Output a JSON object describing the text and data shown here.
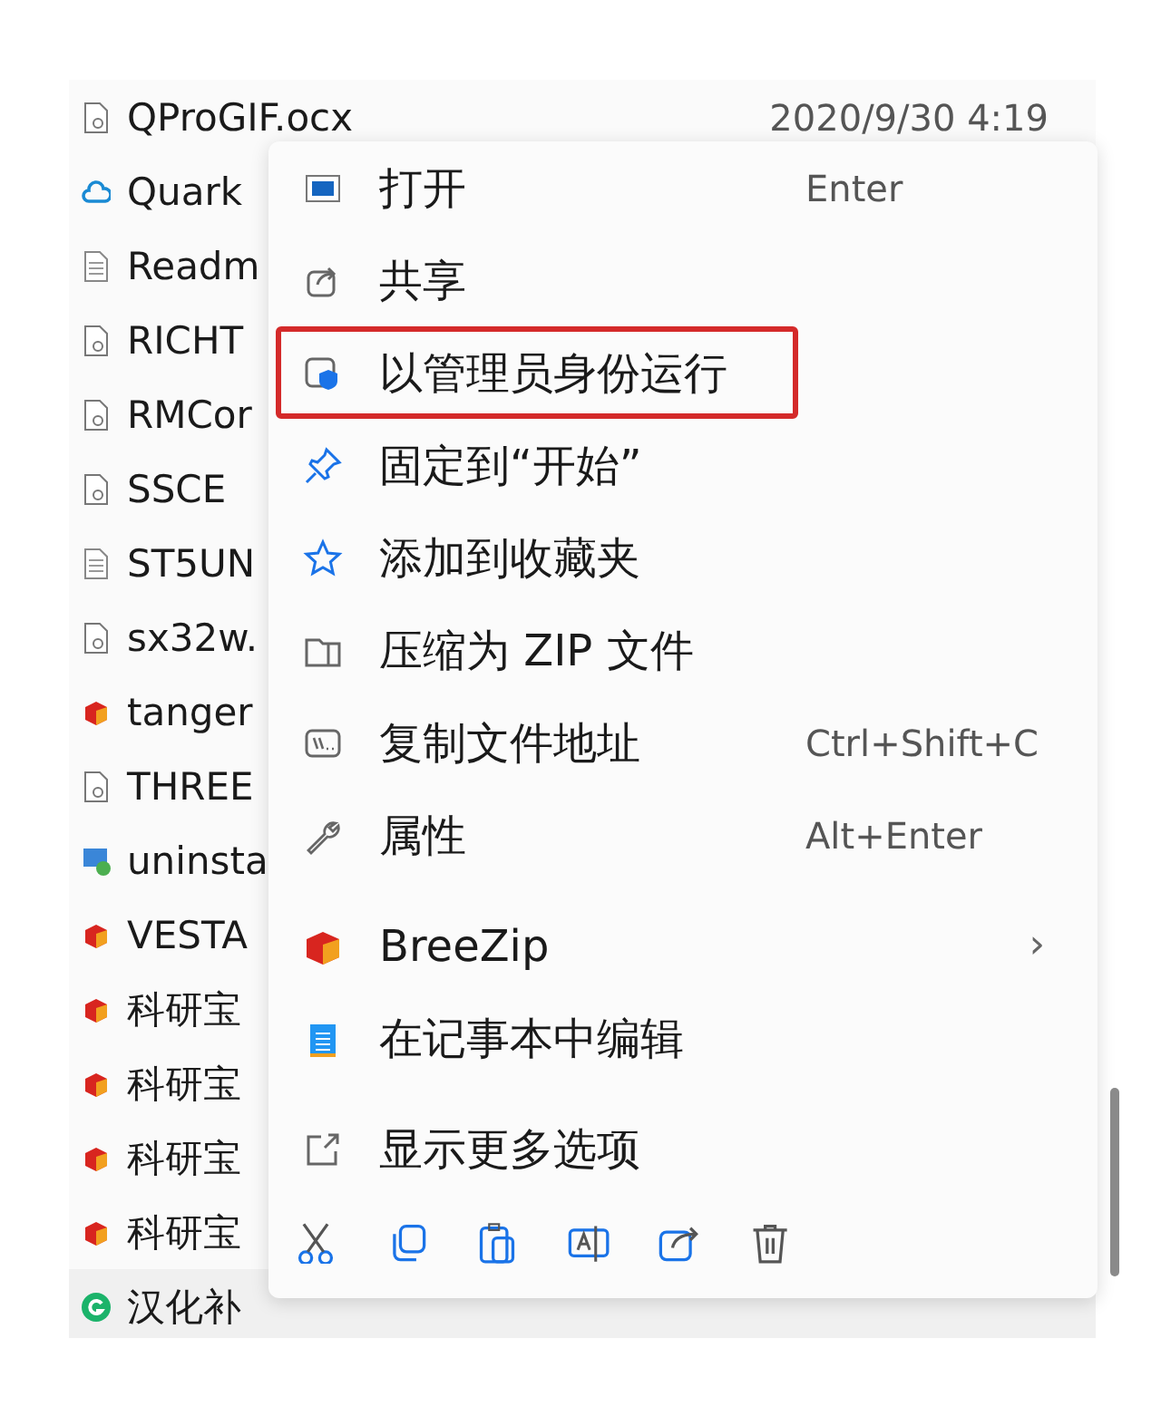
{
  "files": [
    {
      "name": "QProGIF.ocx",
      "kind": "config",
      "date": "2020/9/30 4:19"
    },
    {
      "name": "Quark",
      "kind": "cloud"
    },
    {
      "name": "Readm",
      "kind": "text"
    },
    {
      "name": "RICHT",
      "kind": "config"
    },
    {
      "name": "RMCor",
      "kind": "config"
    },
    {
      "name": "SSCE",
      "kind": "config"
    },
    {
      "name": "ST5UN",
      "kind": "text"
    },
    {
      "name": "sx32w.",
      "kind": "config"
    },
    {
      "name": "tanger",
      "kind": "app"
    },
    {
      "name": "THREE",
      "kind": "config"
    },
    {
      "name": "uninsta",
      "kind": "installer"
    },
    {
      "name": "VESTA",
      "kind": "app"
    },
    {
      "name": "科研宝",
      "kind": "app"
    },
    {
      "name": "科研宝",
      "kind": "app"
    },
    {
      "name": "科研宝",
      "kind": "app"
    },
    {
      "name": "科研宝",
      "kind": "app"
    },
    {
      "name": "汉化补",
      "kind": "green"
    }
  ],
  "context_menu": {
    "groups": [
      [
        {
          "label": "打开",
          "shortcut": "Enter",
          "highlighted": false
        },
        {
          "label": "共享",
          "highlighted": false
        },
        {
          "label": "以管理员身份运行",
          "highlighted": true
        },
        {
          "label": "固定到“开始”",
          "highlighted": false
        },
        {
          "label": "添加到收藏夹",
          "highlighted": false
        },
        {
          "label": "压缩为 ZIP 文件",
          "highlighted": false
        },
        {
          "label": "复制文件地址",
          "shortcut": "Ctrl+Shift+C",
          "highlighted": false
        },
        {
          "label": "属性",
          "shortcut": "Alt+Enter",
          "highlighted": false
        }
      ],
      [
        {
          "label": "BreeZip",
          "submenu": "›",
          "highlighted": false
        },
        {
          "label": "在记事本中编辑",
          "highlighted": false
        }
      ],
      [
        {
          "label": "显示更多选项",
          "highlighted": false
        }
      ]
    ],
    "toolbar": [
      {
        "kind": "cut"
      },
      {
        "kind": "copy"
      },
      {
        "kind": "paste"
      },
      {
        "kind": "rename"
      },
      {
        "kind": "share"
      },
      {
        "kind": "delete"
      }
    ]
  }
}
